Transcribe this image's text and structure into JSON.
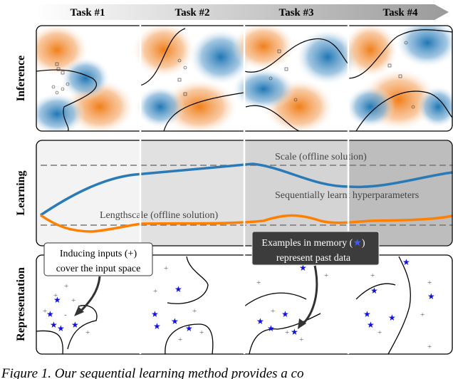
{
  "tasks": [
    "Task #1",
    "Task #2",
    "Task #3",
    "Task #4"
  ],
  "row_labels": {
    "inference": "Inference",
    "learning": "Learning",
    "representation": "Representation"
  },
  "learning": {
    "scale_label": "Scale (offline solution)",
    "lengthscale_label": "Lengthscale (offline solution)",
    "sequential_label": "Sequentially learnt hyperparameters"
  },
  "callouts": {
    "inducing_line1": "Inducing inputs (+)",
    "inducing_line2": "cover the input space",
    "memory_line1": "Examples in memory (",
    "memory_line1_end": ")",
    "memory_line2": "represent past data"
  },
  "caption": "Figure 1. Our sequential learning method provides a co",
  "colors": {
    "class_a": "#f07f1a",
    "class_b": "#1f77b4",
    "memory_star": "#1010e0",
    "scale_line": "#2a7ab8",
    "lengthscale_line": "#ff8000"
  }
}
